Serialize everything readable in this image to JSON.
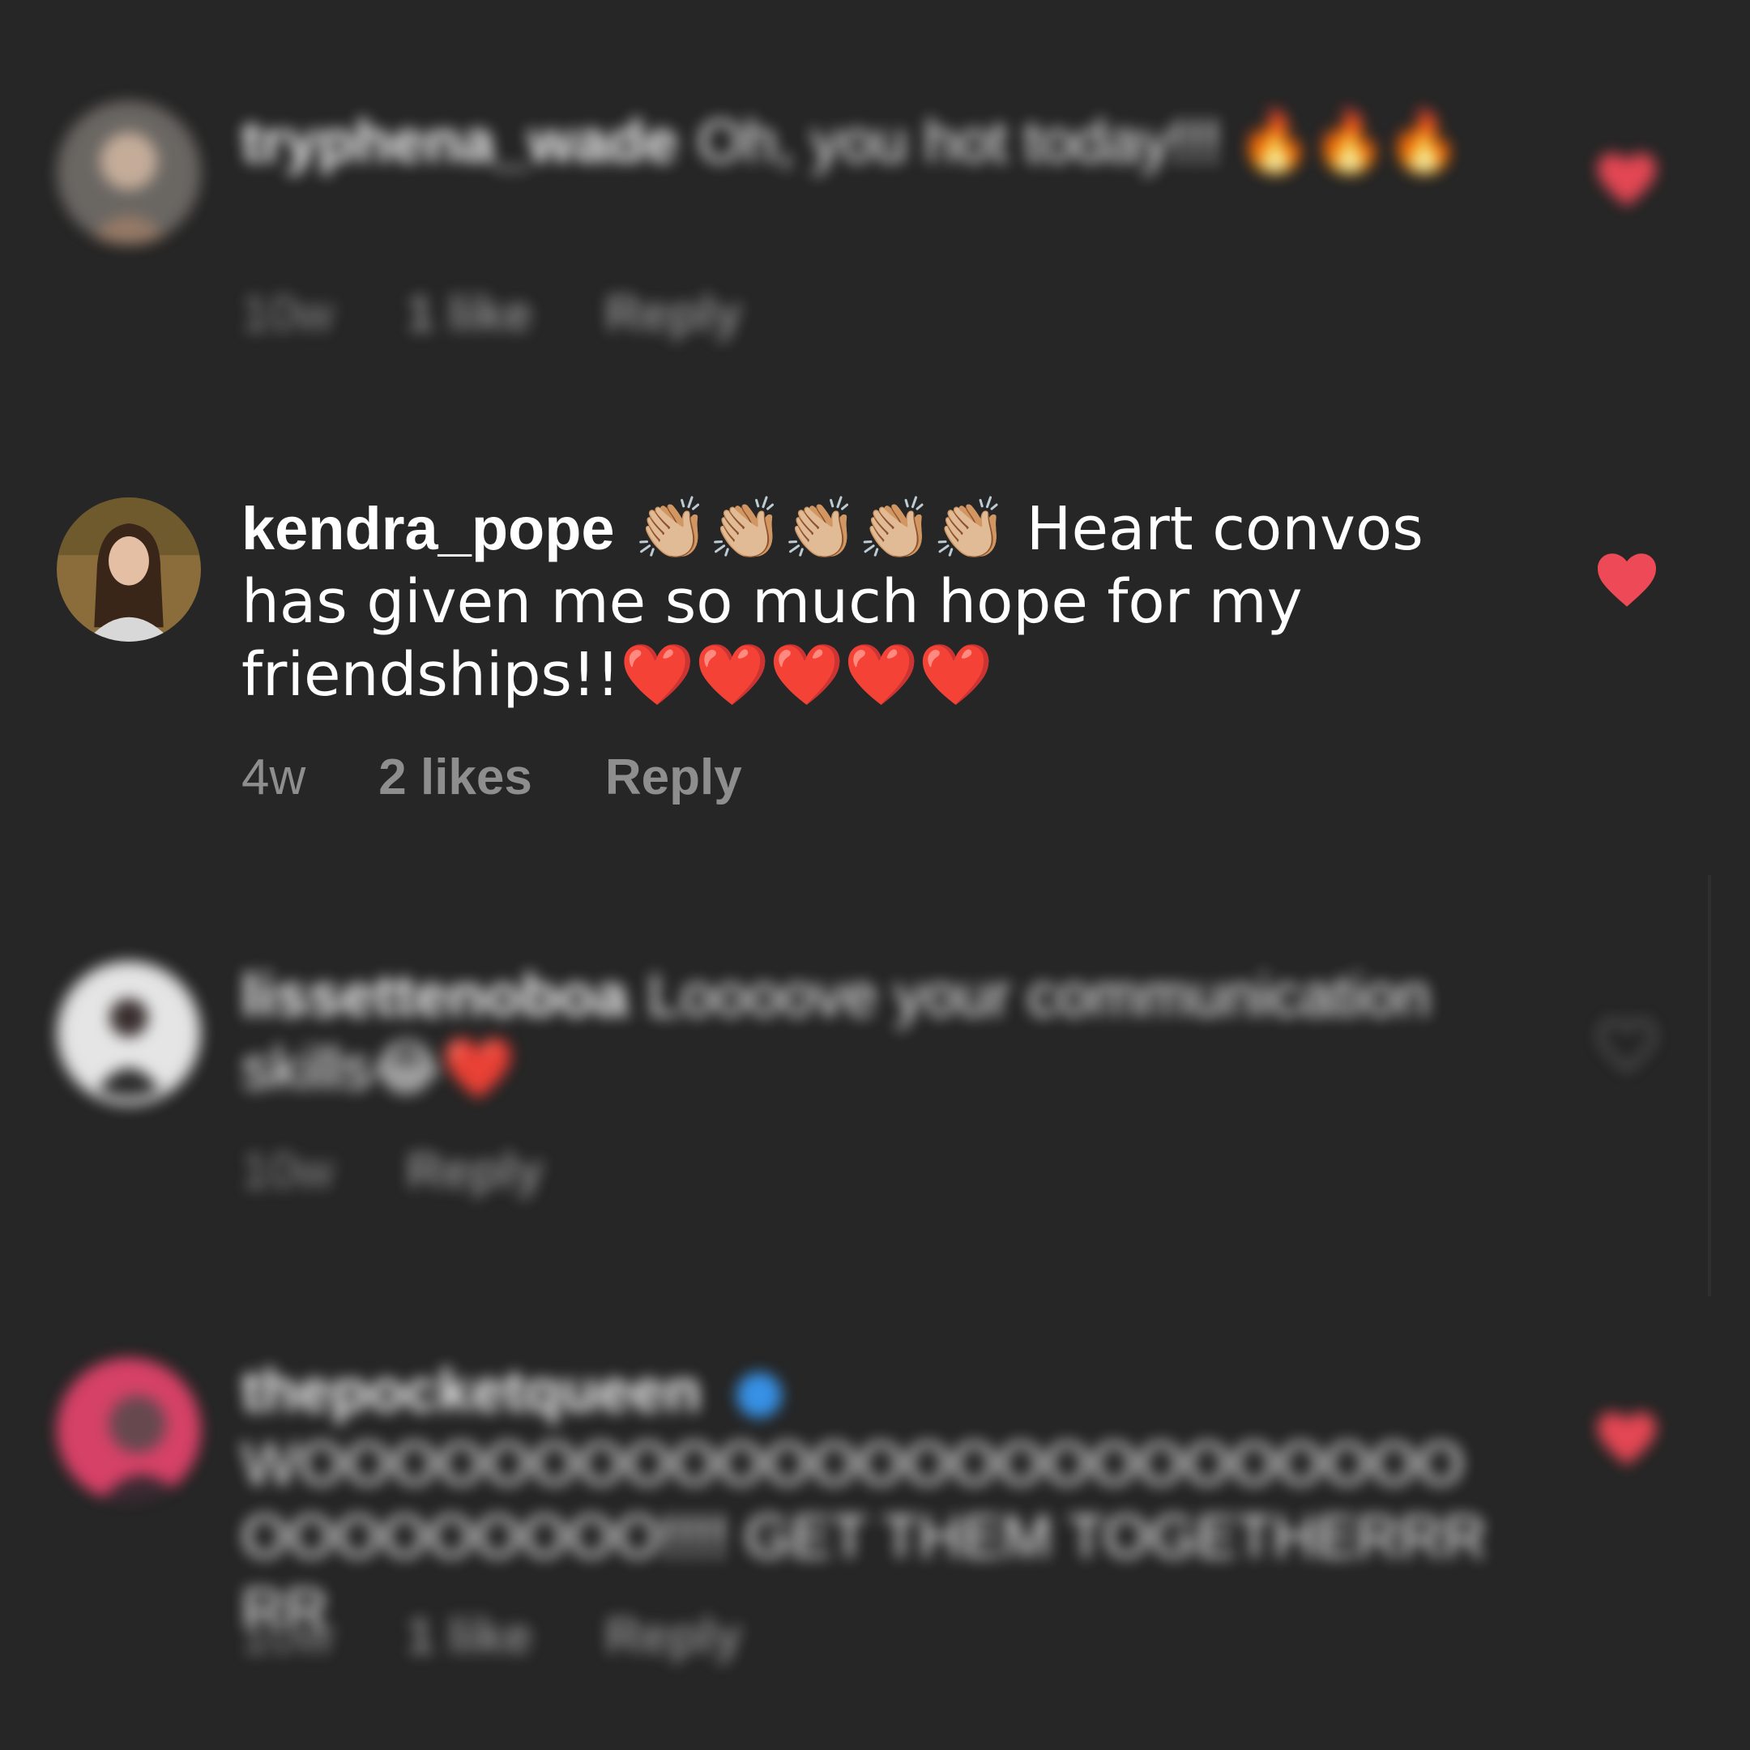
{
  "comments": [
    {
      "username": "tryphena_wade",
      "text": "Oh, you hot today!!! 🔥🔥🔥",
      "time": "10w",
      "likes": "1 like",
      "reply": "Reply",
      "liked": true,
      "blurred": true
    },
    {
      "username": "kendra_pope",
      "text": "👏🏼👏🏼👏🏼👏🏼👏🏼 Heart convos has given me so much hope for my friendships!!❤️❤️❤️❤️❤️",
      "time": "4w",
      "likes": "2 likes",
      "reply": "Reply",
      "liked": true,
      "blurred": false
    },
    {
      "username": "lissettenoboa",
      "text": "Loooove your communication skills😂❤️",
      "time": "10w",
      "reply": "Reply",
      "liked": false,
      "blurred": true
    },
    {
      "username": "thepocketqueen",
      "text": "WOOOOOOOOOOOOOOOOOOOOOOOOOOOOOOOOOO!!!! GET THEM TOGETHERRRRR",
      "time": "10w",
      "likes": "1 like",
      "reply": "Reply",
      "liked": true,
      "blurred": true
    }
  ],
  "colors": {
    "background": "#262626",
    "text": "#ffffff",
    "meta": "#8e8e8e",
    "like_red": "#ed4956",
    "verified_blue": "#3897f0"
  }
}
